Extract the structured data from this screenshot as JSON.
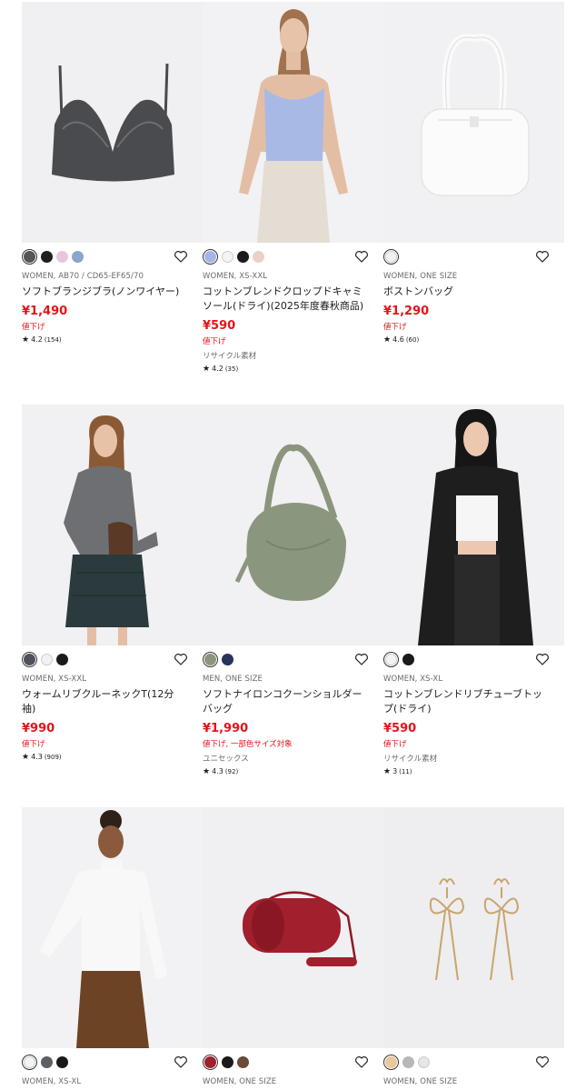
{
  "products": [
    {
      "swatches": [
        "#545557",
        "#1f1f1f",
        "#e9c6dc",
        "#8aa6cc"
      ],
      "category": "WOMEN, AB70 / CD65-EF65/70",
      "name": "ソフトブランジブラ(ノンワイヤー)",
      "price": "¥1,490",
      "sale": "値下げ",
      "note": "",
      "rating": "4.2",
      "count": "(154)"
    },
    {
      "swatches": [
        "#a4b6e6",
        "#f4f4f4",
        "#1a1a1a",
        "#ebd0c8"
      ],
      "category": "WOMEN, XS-XXL",
      "name": "コットンブレンドクロップドキャミソール(ドライ)(2025年度春秋商品)",
      "price": "¥590",
      "sale": "値下げ",
      "note": "リサイクル素材",
      "rating": "4.2",
      "count": "(35)"
    },
    {
      "swatches": [
        "#f2f2f2"
      ],
      "category": "WOMEN, ONE SIZE",
      "name": "ボストンバッグ",
      "price": "¥1,290",
      "sale": "値下げ",
      "note": "",
      "rating": "4.6",
      "count": "(60)"
    },
    {
      "swatches": [
        "#4e5258",
        "#f1f1f1",
        "#1a1a1a"
      ],
      "category": "WOMEN, XS-XXL",
      "name": "ウォームリブクルーネックT(12分袖)",
      "price": "¥990",
      "sale": "値下げ",
      "note": "",
      "rating": "4.3",
      "count": "(909)"
    },
    {
      "swatches": [
        "#8a967c",
        "#25335e"
      ],
      "category": "MEN, ONE SIZE",
      "name": "ソフトナイロンコクーンショルダーバッグ",
      "price": "¥1,990",
      "sale": "値下げ, 一部色サイズ対象",
      "note": "ユニセックス",
      "rating": "4.3",
      "count": "(92)"
    },
    {
      "swatches": [
        "#f3f3f3",
        "#1a1a1a"
      ],
      "category": "WOMEN, XS-XL",
      "name": "コットンブレンドリブチューブトップ(ドライ)",
      "price": "¥590",
      "sale": "値下げ",
      "note": "リサイクル素材",
      "rating": "3",
      "count": "(11)"
    },
    {
      "swatches": [
        "#f4f4f4",
        "#5c5f64",
        "#1a1a1a"
      ],
      "category": "WOMEN, XS-XL",
      "name": "",
      "price": "",
      "sale": "",
      "note": "",
      "rating": "",
      "count": ""
    },
    {
      "swatches": [
        "#a0202e",
        "#1a1a1a",
        "#6b4a3a"
      ],
      "category": "WOMEN, ONE SIZE",
      "name": "",
      "price": "",
      "sale": "",
      "note": "",
      "rating": "",
      "count": ""
    },
    {
      "swatches": [
        "#e9c89c",
        "#b7b7b7",
        "#e6e6e6"
      ],
      "category": "WOMEN, ONE SIZE",
      "name": "",
      "price": "",
      "sale": "",
      "note": "",
      "rating": "",
      "count": ""
    }
  ]
}
